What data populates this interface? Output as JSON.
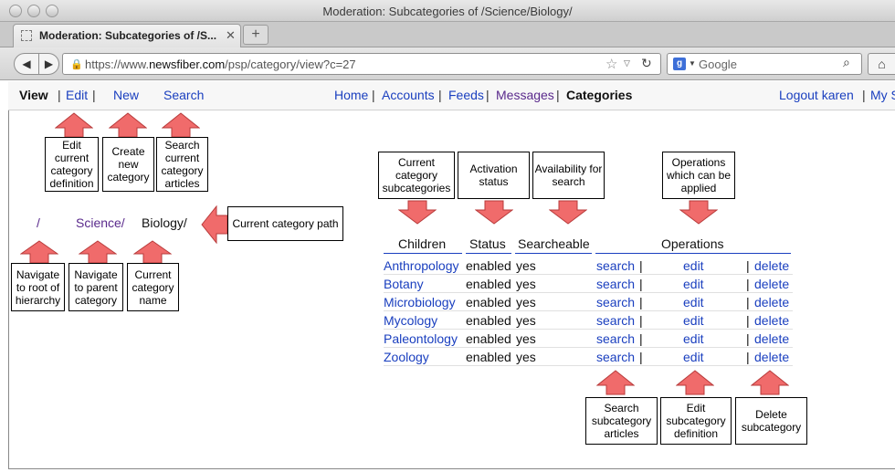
{
  "window": {
    "title": "Moderation: Subcategories of /Science/Biology/"
  },
  "tab": {
    "title": "Moderation: Subcategories of /S...",
    "new_tab": "+"
  },
  "navbar": {
    "url_prefix": "https://www.",
    "url_host": "newsfiber.com",
    "url_path": "/psp/category/view?c=27",
    "search_engine": "Google"
  },
  "header": {
    "view": "View",
    "edit": "Edit",
    "new": "New",
    "search": "Search",
    "nav": {
      "home": "Home",
      "accounts": "Accounts",
      "feeds": "Feeds",
      "messages": "Messages",
      "categories": "Categories"
    },
    "logout": "Logout karen",
    "my": "My S"
  },
  "annotations": {
    "edit_current": "Edit current category definition",
    "create_new": "Create new category",
    "search_current": "Search current category articles",
    "current_path": "Current category path",
    "nav_root": "Navigate to root of hierarchy",
    "nav_parent": "Navigate to parent category",
    "current_name": "Current category name",
    "subcategories": "Current category subcategories",
    "activation": "Activation status",
    "availability": "Availability for search",
    "operations": "Operations which can be applied",
    "search_sub": "Search subcategory articles",
    "edit_sub": "Edit subcategory definition",
    "delete_sub": "Delete subcategory"
  },
  "path": {
    "root": "/",
    "parent": "Science/",
    "current": "Biology/"
  },
  "table": {
    "headers": {
      "children": "Children",
      "status": "Status",
      "searchable": "Searcheable",
      "operations": "Operations"
    },
    "ops": {
      "search": "search",
      "edit": "edit",
      "delete": "delete",
      "pipe_after_search": "|",
      "pipe_before_delete": "|"
    },
    "rows": [
      {
        "name": "Anthropology",
        "status": "enabled",
        "searchable": "yes"
      },
      {
        "name": "Botany",
        "status": "enabled",
        "searchable": "yes"
      },
      {
        "name": "Microbiology",
        "status": "enabled",
        "searchable": "yes"
      },
      {
        "name": "Mycology",
        "status": "enabled",
        "searchable": "yes"
      },
      {
        "name": "Paleontology",
        "status": "enabled",
        "searchable": "yes"
      },
      {
        "name": "Zoology",
        "status": "enabled",
        "searchable": "yes"
      }
    ]
  },
  "colors": {
    "link": "#1a3fbf",
    "visited": "#5a2a8c",
    "arrow_fill": "#f06b6b"
  }
}
